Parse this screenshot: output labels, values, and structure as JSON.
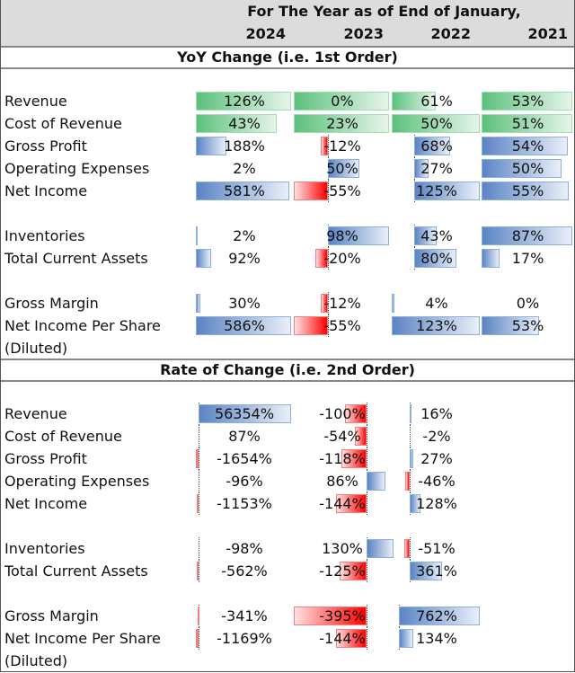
{
  "header": {
    "title": "For The Year as of End of January,",
    "years": [
      "2024",
      "2023",
      "2022",
      "2021"
    ]
  },
  "colors": {
    "positive_bar": "#5b84c4",
    "negative_bar": "#ff0000",
    "cost_bar": "#5cc17c",
    "header_bg": "#dcdcdc"
  },
  "sections": [
    {
      "title": "YoY Change (i.e. 1st Order)",
      "rows": [
        {
          "label": "Revenue",
          "style": "grn",
          "cells": [
            {
              "value": "126%",
              "axis": 0,
              "level": 1.0
            },
            {
              "value": "0%",
              "axis": 0,
              "level": 1.0
            },
            {
              "value": "61%",
              "axis": 0,
              "level": 0.5
            },
            {
              "value": "53%",
              "axis": 0,
              "level": 1.0
            }
          ]
        },
        {
          "label": "Cost of Revenue",
          "style": "grn",
          "cells": [
            {
              "value": "43%",
              "axis": 0,
              "level": 0.85
            },
            {
              "value": "23%",
              "axis": 0,
              "level": 1.0
            },
            {
              "value": "50%",
              "axis": 0,
              "level": 1.0
            },
            {
              "value": "51%",
              "axis": 0,
              "level": 1.0
            }
          ]
        },
        {
          "label": "Gross Profit",
          "cells": [
            {
              "value": "188%",
              "axis": 0,
              "level": 0.32
            },
            {
              "value": "-12%",
              "axis": 0.36,
              "level": -0.08
            },
            {
              "value": "68%",
              "axis": 0.26,
              "level": 0.4
            },
            {
              "value": "54%",
              "axis": 0,
              "level": 0.95
            }
          ]
        },
        {
          "label": "Operating Expenses",
          "cells": [
            {
              "value": "2%",
              "axis": 0,
              "level": 0.0
            },
            {
              "value": "50%",
              "axis": 0.36,
              "level": 0.33
            },
            {
              "value": "27%",
              "axis": 0.26,
              "level": 0.16
            },
            {
              "value": "50%",
              "axis": 0,
              "level": 0.88
            }
          ]
        },
        {
          "label": "Net Income",
          "cells": [
            {
              "value": "581%",
              "axis": 0,
              "level": 0.98
            },
            {
              "value": "-55%",
              "axis": 0.36,
              "level": -0.36
            },
            {
              "value": "125%",
              "axis": 0.26,
              "level": 0.74
            },
            {
              "value": "55%",
              "axis": 0,
              "level": 0.96
            }
          ]
        },
        {
          "spacer": true
        },
        {
          "label": "Inventories",
          "cells": [
            {
              "value": "2%",
              "axis": 0,
              "level": 0.01
            },
            {
              "value": "98%",
              "axis": 0.36,
              "level": 0.64
            },
            {
              "value": "43%",
              "axis": 0.26,
              "level": 0.25
            },
            {
              "value": "87%",
              "axis": 0,
              "level": 1.0
            }
          ]
        },
        {
          "label": "Total Current Assets",
          "cells": [
            {
              "value": "92%",
              "axis": 0,
              "level": 0.16
            },
            {
              "value": "-20%",
              "axis": 0.36,
              "level": -0.13
            },
            {
              "value": "80%",
              "axis": 0.26,
              "level": 0.47
            },
            {
              "value": "17%",
              "axis": 0,
              "level": 0.2
            }
          ]
        },
        {
          "spacer": true
        },
        {
          "label": "Gross Margin",
          "cells": [
            {
              "value": "30%",
              "axis": 0,
              "level": 0.05
            },
            {
              "value": "-12%",
              "axis": 0.36,
              "level": -0.08
            },
            {
              "value": "4%",
              "axis": 0,
              "level": 0.03
            },
            {
              "value": "0%",
              "axis": 0,
              "level": 0.0
            }
          ]
        },
        {
          "label": "Net Income Per Share",
          "label2": "(Diluted)",
          "cells": [
            {
              "value": "586%",
              "axis": 0,
              "level": 1.0
            },
            {
              "value": "-55%",
              "axis": 0.36,
              "level": -0.36
            },
            {
              "value": "123%",
              "axis": 0,
              "level": 1.0
            },
            {
              "value": "53%",
              "axis": 0,
              "level": 0.63
            }
          ]
        }
      ]
    },
    {
      "title": "Rate of Change (i.e. 2nd Order)",
      "rows": [
        {
          "label": "Revenue",
          "cells": [
            {
              "value": "56354%",
              "axis": 0.03,
              "level": 0.97
            },
            {
              "value": "-100%",
              "axis": 0.76,
              "level": -0.22
            },
            {
              "value": "16%",
              "axis": 0.2,
              "level": 0.02
            },
            {
              "value": "",
              "axis": 0,
              "level": 0
            }
          ]
        },
        {
          "label": "Cost of Revenue",
          "cells": [
            {
              "value": "87%",
              "axis": 0.03,
              "level": 0.0
            },
            {
              "value": "-54%",
              "axis": 0.76,
              "level": -0.12
            },
            {
              "value": "-2%",
              "axis": 0.2,
              "level": 0.0
            },
            {
              "value": "",
              "axis": 0,
              "level": 0
            }
          ]
        },
        {
          "label": "Gross Profit",
          "cells": [
            {
              "value": "-1654%",
              "axis": 0.03,
              "level": -0.03
            },
            {
              "value": "-118%",
              "axis": 0.76,
              "level": -0.26
            },
            {
              "value": "27%",
              "axis": 0.2,
              "level": 0.04
            },
            {
              "value": "",
              "axis": 0,
              "level": 0
            }
          ]
        },
        {
          "label": "Operating Expenses",
          "cells": [
            {
              "value": "-96%",
              "axis": 0.03,
              "level": 0.0
            },
            {
              "value": "86%",
              "axis": 0.76,
              "level": 0.2
            },
            {
              "value": "-46%",
              "axis": 0.2,
              "level": -0.05
            },
            {
              "value": "",
              "axis": 0,
              "level": 0
            }
          ]
        },
        {
          "label": "Net Income",
          "cells": [
            {
              "value": "-1153%",
              "axis": 0.03,
              "level": -0.02
            },
            {
              "value": "-144%",
              "axis": 0.76,
              "level": -0.32
            },
            {
              "value": "128%",
              "axis": 0.2,
              "level": 0.13
            },
            {
              "value": "",
              "axis": 0,
              "level": 0
            }
          ]
        },
        {
          "spacer": true
        },
        {
          "label": "Inventories",
          "cells": [
            {
              "value": "-98%",
              "axis": 0.03,
              "level": 0.0
            },
            {
              "value": "130%",
              "axis": 0.76,
              "level": 0.29
            },
            {
              "value": "-51%",
              "axis": 0.2,
              "level": -0.06
            },
            {
              "value": "",
              "axis": 0,
              "level": 0
            }
          ]
        },
        {
          "label": "Total Current Assets",
          "cells": [
            {
              "value": "-562%",
              "axis": 0.03,
              "level": -0.02
            },
            {
              "value": "-125%",
              "axis": 0.76,
              "level": -0.28
            },
            {
              "value": "361%",
              "axis": 0.2,
              "level": 0.37
            },
            {
              "value": "",
              "axis": 0,
              "level": 0
            }
          ]
        },
        {
          "spacer": true
        },
        {
          "label": "Gross Margin",
          "cells": [
            {
              "value": "-341%",
              "axis": 0.03,
              "level": -0.01
            },
            {
              "value": "-395%",
              "axis": 0.76,
              "level": -0.76
            },
            {
              "value": "762%",
              "axis": 0.08,
              "level": 0.92
            },
            {
              "value": "",
              "axis": 0,
              "level": 0
            }
          ]
        },
        {
          "label": "Net Income Per Share",
          "label2": "(Diluted)",
          "cells": [
            {
              "value": "-1169%",
              "axis": 0.03,
              "level": -0.03
            },
            {
              "value": "-144%",
              "axis": 0.76,
              "level": -0.32
            },
            {
              "value": "134%",
              "axis": 0.08,
              "level": 0.16
            },
            {
              "value": "",
              "axis": 0,
              "level": 0
            }
          ]
        }
      ]
    }
  ]
}
